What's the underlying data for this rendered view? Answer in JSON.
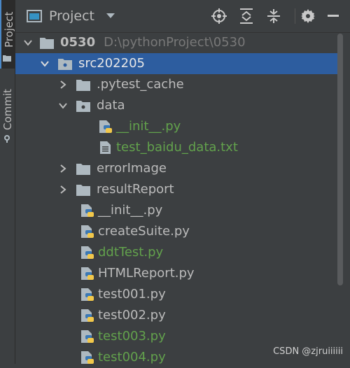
{
  "tool_strip": {
    "project_tab": "Project",
    "commit_tab": "Commit"
  },
  "header": {
    "title": "Project",
    "icons": [
      "locate-icon",
      "expand-all-icon",
      "collapse-all-icon",
      "settings-icon"
    ]
  },
  "tree": {
    "root": {
      "name": "0530",
      "path": "D:\\pythonProject\\0530"
    },
    "items": [
      {
        "name": "src202205",
        "type": "package",
        "selected": true
      },
      {
        "name": ".pytest_cache",
        "type": "folder"
      },
      {
        "name": "data",
        "type": "package"
      },
      {
        "name": "__init__.py",
        "type": "python-file",
        "status": "new"
      },
      {
        "name": "test_baidu_data.txt",
        "type": "text-file",
        "status": "new"
      },
      {
        "name": "errorImage",
        "type": "folder"
      },
      {
        "name": "resultReport",
        "type": "folder"
      },
      {
        "name": "__init__.py",
        "type": "python-file"
      },
      {
        "name": "createSuite.py",
        "type": "python-file"
      },
      {
        "name": "ddtTest.py",
        "type": "python-file",
        "status": "new"
      },
      {
        "name": "HTMLReport.py",
        "type": "python-file"
      },
      {
        "name": "test001.py",
        "type": "python-file"
      },
      {
        "name": "test002.py",
        "type": "python-file"
      },
      {
        "name": "test003.py",
        "type": "python-file",
        "status": "new"
      },
      {
        "name": "test004.py",
        "type": "python-file",
        "status": "new"
      }
    ]
  },
  "colors": {
    "background": "#3c3f41",
    "selection": "#2d5d9f",
    "new_file_text": "#62a14c",
    "text": "#bbbbbb"
  },
  "watermark": "CSDN @zjruiiiiii"
}
